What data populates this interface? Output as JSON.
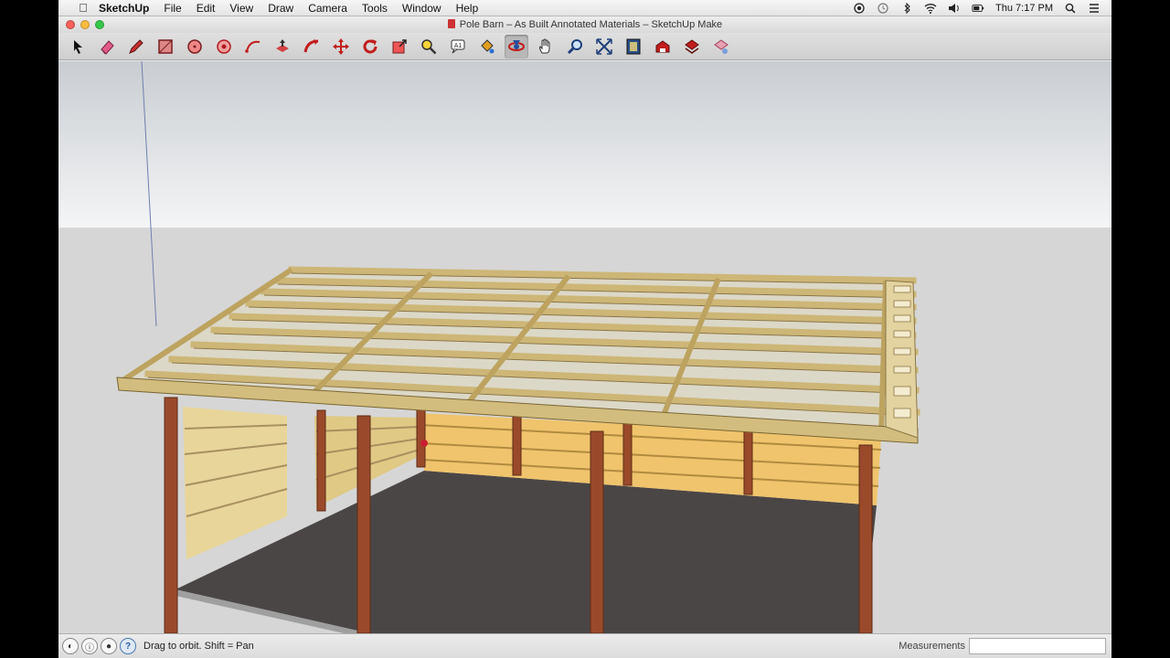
{
  "menubar": {
    "apple_glyph": "",
    "app_name": "SketchUp",
    "items": [
      "File",
      "Edit",
      "View",
      "Draw",
      "Camera",
      "Tools",
      "Window",
      "Help"
    ],
    "clock": "Thu 7:17 PM"
  },
  "window": {
    "title": "Pole Barn – As Built Annotated Materials – SketchUp Make"
  },
  "toolbar": {
    "tools": [
      {
        "name": "select-tool",
        "icon": "arrow-icon"
      },
      {
        "name": "eraser-tool",
        "icon": "eraser-icon"
      },
      {
        "name": "line-tool",
        "icon": "pencil-icon"
      },
      {
        "name": "rectangle-tool",
        "icon": "rectangle-icon"
      },
      {
        "name": "circle-tool",
        "icon": "circle-icon"
      },
      {
        "name": "polygon-tool",
        "icon": "polygon-icon"
      },
      {
        "name": "arc-tool",
        "icon": "arc-icon"
      },
      {
        "name": "push-pull-tool",
        "icon": "push-pull-icon"
      },
      {
        "name": "follow-me-tool",
        "icon": "follow-me-icon"
      },
      {
        "name": "move-tool",
        "icon": "move-icon"
      },
      {
        "name": "rotate-tool",
        "icon": "rotate-icon"
      },
      {
        "name": "scale-tool",
        "icon": "scale-icon"
      },
      {
        "name": "tape-measure-tool",
        "icon": "tape-icon"
      },
      {
        "name": "text-tool",
        "icon": "text-icon"
      },
      {
        "name": "paint-bucket-tool",
        "icon": "paint-bucket-icon"
      },
      {
        "name": "orbit-tool",
        "icon": "orbit-icon"
      },
      {
        "name": "pan-tool",
        "icon": "hand-icon"
      },
      {
        "name": "zoom-tool",
        "icon": "magnifier-icon"
      },
      {
        "name": "zoom-extents-tool",
        "icon": "zoom-extents-icon"
      },
      {
        "name": "previous-view-tool",
        "icon": "previous-icon"
      },
      {
        "name": "warehouse-tool",
        "icon": "warehouse-icon"
      },
      {
        "name": "share-model-tool",
        "icon": "share-icon"
      },
      {
        "name": "extension-tool",
        "icon": "extension-icon"
      }
    ],
    "active_tool": "orbit-tool"
  },
  "statusbar": {
    "hint": "Drag to orbit.  Shift = Pan",
    "measurements_label": "Measurements",
    "measurements_value": ""
  },
  "colors": {
    "lumber": "#d9c48a",
    "post": "#9a4a2a",
    "wall_panel": "#e8b45a",
    "floor": "#4b4646",
    "accent_red": "#c8202f"
  }
}
